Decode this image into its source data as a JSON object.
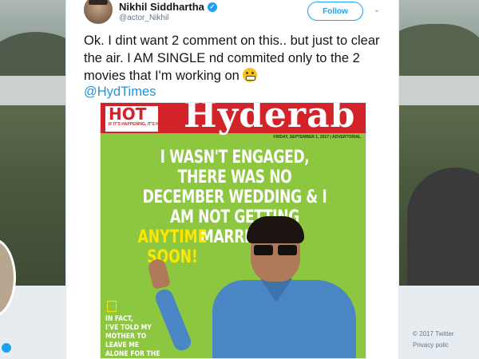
{
  "tweet": {
    "author_name": "Nikhil Siddhartha",
    "handle": "@actor_Nikhil",
    "verified_icon": "verified-badge-icon",
    "follow_label": "Follow",
    "text": "Ok. I dint want 2 comment on this.. but just to clear the air. I AM SINGLE nd commited only to the 2 movies that I'm working on",
    "emoji": "grimacing-face",
    "mention": "@HydTimes"
  },
  "cover": {
    "brand": "Hyderab",
    "section_badge": "HOT",
    "section_tagline": "IF IT'S HAPPENING, IT'S HERE",
    "date_line": "FRIDAY, SEPTEMBER 1, 2017 | ADVERTORIAL",
    "headline": "I WASN'T ENGAGED, THERE WAS NO DECEMBER WEDDING & I AM NOT GETTING MARRIED",
    "headline_highlight": "ANYTIME SOON!",
    "side_quote_lines": [
      "IN FACT,",
      "I'VE TOLD MY",
      "MOTHER TO",
      "LEAVE ME",
      "ALONE FOR THE"
    ]
  },
  "background_footer": {
    "copyright": "© 2017 Twitter",
    "privacy": "Privacy polic"
  },
  "colors": {
    "accent": "#1da1f2",
    "link": "#1b95e0",
    "cover_red": "#d2232a",
    "cover_green": "#8dc63f",
    "highlight_yellow": "#ffe600"
  }
}
